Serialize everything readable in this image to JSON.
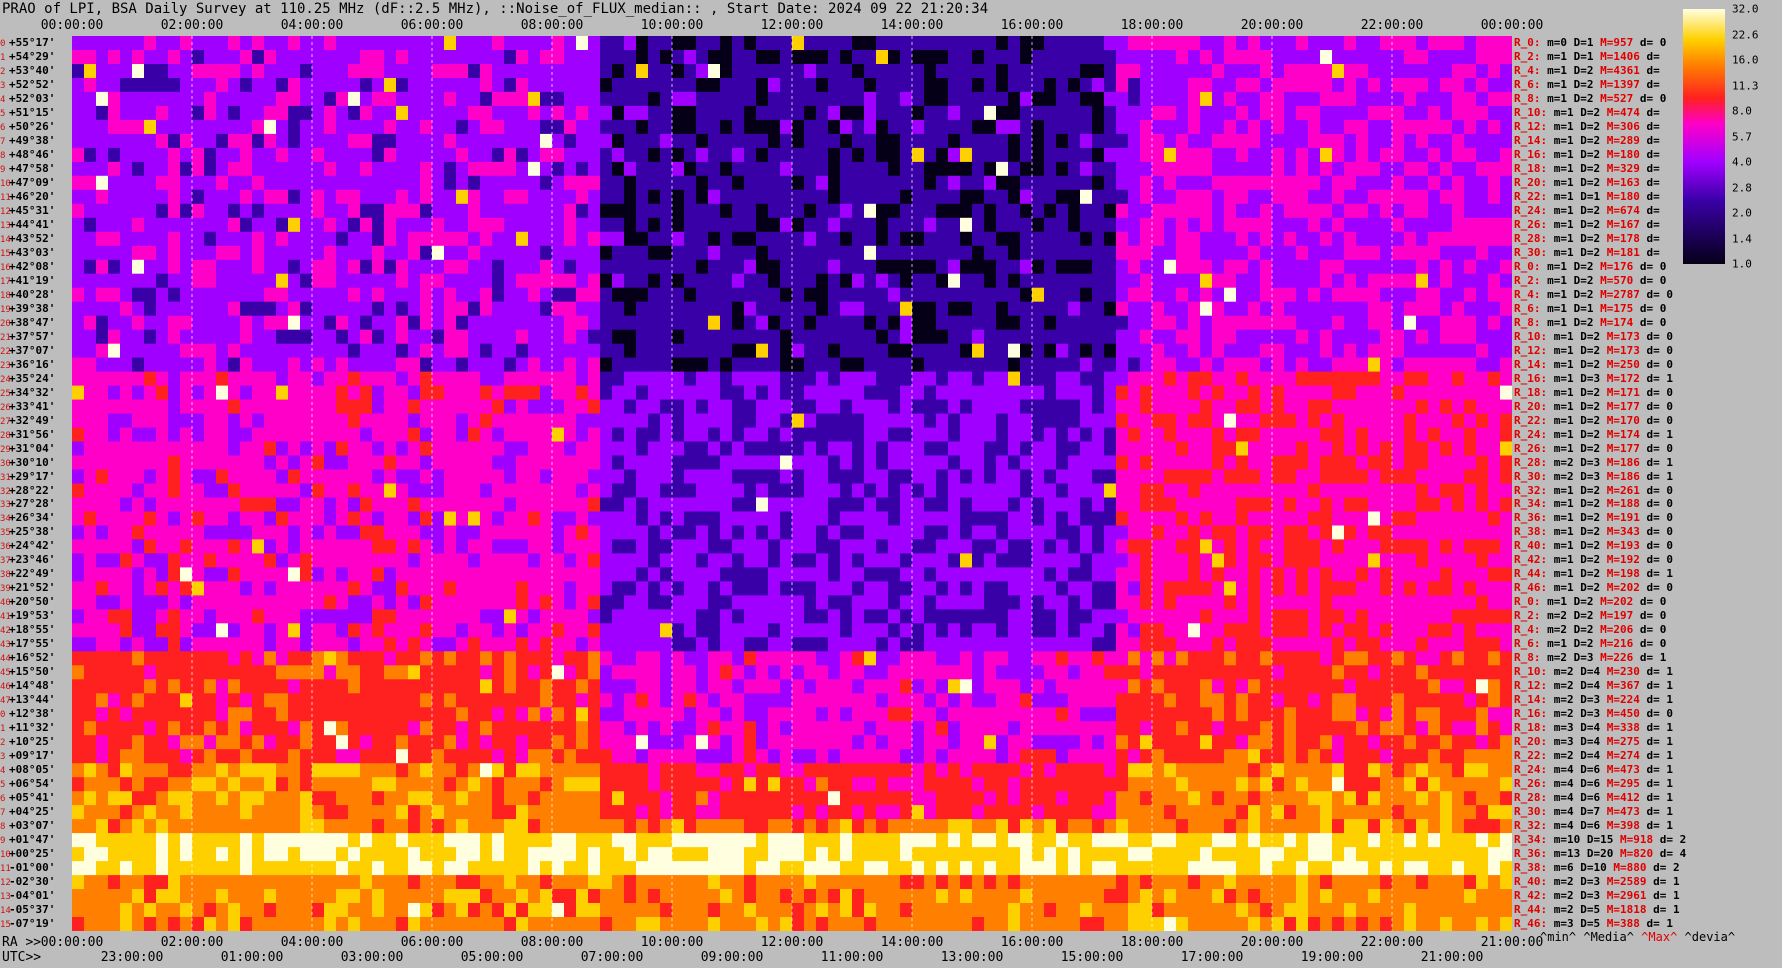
{
  "title": "PRAO of LPI, BSA Daily Survey at 110.25 MHz (dF::2.5 MHz), ::Noise_of_FLUX_median:: , Start Date: 2024 09 22 21:20:34",
  "top_axis": [
    "00:00:00",
    "02:00:00",
    "04:00:00",
    "06:00:00",
    "08:00:00",
    "10:00:00",
    "12:00:00",
    "14:00:00",
    "16:00:00",
    "18:00:00",
    "20:00:00",
    "22:00:00",
    "00:00:00"
  ],
  "ra_axis": {
    "prefix": "RA >>",
    "labels": [
      "00:00:00",
      "02:00:00",
      "04:00:00",
      "06:00:00",
      "08:00:00",
      "10:00:00",
      "12:00:00",
      "14:00:00",
      "16:00:00",
      "18:00:00",
      "20:00:00",
      "22:00:00",
      "21:00:00"
    ]
  },
  "utc_axis": {
    "prefix": "UTC>>",
    "labels": [
      "23:00:00",
      "01:00:00",
      "03:00:00",
      "05:00:00",
      "07:00:00",
      "09:00:00",
      "11:00:00",
      "13:00:00",
      "15:00:00",
      "17:00:00",
      "19:00:00",
      "21:00:00"
    ]
  },
  "colorbar": {
    "ticks": [
      "32.0",
      "22.6",
      "16.0",
      "11.3",
      "8.0",
      "5.7",
      "4.0",
      "2.8",
      "2.0",
      "1.4",
      "1.0"
    ]
  },
  "declinations": [
    "+55°17'",
    "+54°29'",
    "+53°40'",
    "+52°52'",
    "+52°03'",
    "+51°15'",
    "+50°26'",
    "+49°38'",
    "+48°46'",
    "+47°58'",
    "+47°09'",
    "+46°20'",
    "+45°31'",
    "+44°41'",
    "+43°52'",
    "+43°03'",
    "+42°08'",
    "+41°19'",
    "+40°28'",
    "+39°38'",
    "+38°47'",
    "+37°57'",
    "+37°07'",
    "+36°16'",
    "+35°24'",
    "+34°32'",
    "+33°41'",
    "+32°49'",
    "+31°56'",
    "+31°04'",
    "+30°10'",
    "+29°17'",
    "+28°22'",
    "+27°28'",
    "+26°34'",
    "+25°38'",
    "+24°42'",
    "+23°46'",
    "+22°49'",
    "+21°52'",
    "+20°50'",
    "+19°53'",
    "+18°55'",
    "+17°55'",
    "+16°52'",
    "+15°50'",
    "+14°48'",
    "+13°44'",
    "+12°38'",
    "+11°32'",
    "+10°25'",
    "+09°17'",
    "+08°05'",
    "+06°54'",
    "+05°41'",
    "+04°25'",
    "+03°07'",
    "+01°47'",
    "+00°25'",
    "-01°00'",
    "-02°30'",
    "-04°01'",
    "-05°37'",
    "-07°19'"
  ],
  "stats": [
    {
      "r": "R_0:",
      "m": "m=0",
      "d": "D=1",
      "mx": "M=957",
      "dev": "d= 0"
    },
    {
      "r": "R_2:",
      "m": "m=1",
      "d": "D=1",
      "mx": "M=1406",
      "dev": "d="
    },
    {
      "r": "R_4:",
      "m": "m=1",
      "d": "D=2",
      "mx": "M=4361",
      "dev": "d="
    },
    {
      "r": "R_6:",
      "m": "m=1",
      "d": "D=2",
      "mx": "M=1397",
      "dev": "d="
    },
    {
      "r": "R_8:",
      "m": "m=1",
      "d": "D=2",
      "mx": "M=527",
      "dev": "d= 0"
    },
    {
      "r": "R_10:",
      "m": "m=1",
      "d": "D=2",
      "mx": "M=474",
      "dev": "d="
    },
    {
      "r": "R_12:",
      "m": "m=1",
      "d": "D=2",
      "mx": "M=306",
      "dev": "d="
    },
    {
      "r": "R_14:",
      "m": "m=1",
      "d": "D=2",
      "mx": "M=289",
      "dev": "d="
    },
    {
      "r": "R_16:",
      "m": "m=1",
      "d": "D=2",
      "mx": "M=180",
      "dev": "d="
    },
    {
      "r": "R_18:",
      "m": "m=1",
      "d": "D=2",
      "mx": "M=329",
      "dev": "d="
    },
    {
      "r": "R_20:",
      "m": "m=1",
      "d": "D=2",
      "mx": "M=163",
      "dev": "d="
    },
    {
      "r": "R_22:",
      "m": "m=1",
      "d": "D=1",
      "mx": "M=180",
      "dev": "d="
    },
    {
      "r": "R_24:",
      "m": "m=1",
      "d": "D=2",
      "mx": "M=674",
      "dev": "d="
    },
    {
      "r": "R_26:",
      "m": "m=1",
      "d": "D=2",
      "mx": "M=167",
      "dev": "d="
    },
    {
      "r": "R_28:",
      "m": "m=1",
      "d": "D=2",
      "mx": "M=178",
      "dev": "d="
    },
    {
      "r": "R_30:",
      "m": "m=1",
      "d": "D=2",
      "mx": "M=181",
      "dev": "d="
    },
    {
      "r": "R_0:",
      "m": "m=1",
      "d": "D=2",
      "mx": "M=176",
      "dev": "d= 0"
    },
    {
      "r": "R_2:",
      "m": "m=1",
      "d": "D=2",
      "mx": "M=570",
      "dev": "d= 0"
    },
    {
      "r": "R_4:",
      "m": "m=1",
      "d": "D=2",
      "mx": "M=2787",
      "dev": "d= 0"
    },
    {
      "r": "R_6:",
      "m": "m=1",
      "d": "D=1",
      "mx": "M=175",
      "dev": "d= 0"
    },
    {
      "r": "R_8:",
      "m": "m=1",
      "d": "D=2",
      "mx": "M=174",
      "dev": "d= 0"
    },
    {
      "r": "R_10:",
      "m": "m=1",
      "d": "D=2",
      "mx": "M=173",
      "dev": "d= 0"
    },
    {
      "r": "R_12:",
      "m": "m=1",
      "d": "D=2",
      "mx": "M=173",
      "dev": "d= 0"
    },
    {
      "r": "R_14:",
      "m": "m=1",
      "d": "D=2",
      "mx": "M=250",
      "dev": "d= 0"
    },
    {
      "r": "R_16:",
      "m": "m=1",
      "d": "D=3",
      "mx": "M=172",
      "dev": "d= 1"
    },
    {
      "r": "R_18:",
      "m": "m=1",
      "d": "D=2",
      "mx": "M=171",
      "dev": "d= 0"
    },
    {
      "r": "R_20:",
      "m": "m=1",
      "d": "D=2",
      "mx": "M=177",
      "dev": "d= 0"
    },
    {
      "r": "R_22:",
      "m": "m=1",
      "d": "D=2",
      "mx": "M=170",
      "dev": "d= 0"
    },
    {
      "r": "R_24:",
      "m": "m=1",
      "d": "D=2",
      "mx": "M=174",
      "dev": "d= 1"
    },
    {
      "r": "R_26:",
      "m": "m=1",
      "d": "D=2",
      "mx": "M=177",
      "dev": "d= 0"
    },
    {
      "r": "R_28:",
      "m": "m=2",
      "d": "D=3",
      "mx": "M=186",
      "dev": "d= 1"
    },
    {
      "r": "R_30:",
      "m": "m=2",
      "d": "D=3",
      "mx": "M=186",
      "dev": "d= 1"
    },
    {
      "r": "R_32:",
      "m": "m=1",
      "d": "D=2",
      "mx": "M=261",
      "dev": "d= 0"
    },
    {
      "r": "R_34:",
      "m": "m=1",
      "d": "D=2",
      "mx": "M=188",
      "dev": "d= 0"
    },
    {
      "r": "R_36:",
      "m": "m=1",
      "d": "D=2",
      "mx": "M=191",
      "dev": "d= 0"
    },
    {
      "r": "R_38:",
      "m": "m=1",
      "d": "D=2",
      "mx": "M=343",
      "dev": "d= 0"
    },
    {
      "r": "R_40:",
      "m": "m=1",
      "d": "D=2",
      "mx": "M=193",
      "dev": "d= 0"
    },
    {
      "r": "R_42:",
      "m": "m=1",
      "d": "D=2",
      "mx": "M=192",
      "dev": "d= 0"
    },
    {
      "r": "R_44:",
      "m": "m=1",
      "d": "D=2",
      "mx": "M=198",
      "dev": "d= 1"
    },
    {
      "r": "R_46:",
      "m": "m=1",
      "d": "D=2",
      "mx": "M=202",
      "dev": "d= 0"
    },
    {
      "r": "R_0:",
      "m": "m=1",
      "d": "D=2",
      "mx": "M=202",
      "dev": "d= 0"
    },
    {
      "r": "R_2:",
      "m": "m=2",
      "d": "D=2",
      "mx": "M=197",
      "dev": "d= 0"
    },
    {
      "r": "R_4:",
      "m": "m=2",
      "d": "D=2",
      "mx": "M=206",
      "dev": "d= 0"
    },
    {
      "r": "R_6:",
      "m": "m=1",
      "d": "D=2",
      "mx": "M=216",
      "dev": "d= 0"
    },
    {
      "r": "R_8:",
      "m": "m=2",
      "d": "D=3",
      "mx": "M=226",
      "dev": "d= 1"
    },
    {
      "r": "R_10:",
      "m": "m=2",
      "d": "D=4",
      "mx": "M=230",
      "dev": "d= 1"
    },
    {
      "r": "R_12:",
      "m": "m=2",
      "d": "D=4",
      "mx": "M=367",
      "dev": "d= 1"
    },
    {
      "r": "R_14:",
      "m": "m=2",
      "d": "D=3",
      "mx": "M=224",
      "dev": "d= 1"
    },
    {
      "r": "R_16:",
      "m": "m=2",
      "d": "D=3",
      "mx": "M=450",
      "dev": "d= 0"
    },
    {
      "r": "R_18:",
      "m": "m=3",
      "d": "D=4",
      "mx": "M=338",
      "dev": "d= 1"
    },
    {
      "r": "R_20:",
      "m": "m=3",
      "d": "D=4",
      "mx": "M=275",
      "dev": "d= 1"
    },
    {
      "r": "R_22:",
      "m": "m=2",
      "d": "D=4",
      "mx": "M=274",
      "dev": "d= 1"
    },
    {
      "r": "R_24:",
      "m": "m=4",
      "d": "D=6",
      "mx": "M=473",
      "dev": "d= 1"
    },
    {
      "r": "R_26:",
      "m": "m=4",
      "d": "D=6",
      "mx": "M=295",
      "dev": "d= 1"
    },
    {
      "r": "R_28:",
      "m": "m=4",
      "d": "D=6",
      "mx": "M=412",
      "dev": "d= 1"
    },
    {
      "r": "R_30:",
      "m": "m=4",
      "d": "D=7",
      "mx": "M=473",
      "dev": "d= 1"
    },
    {
      "r": "R_32:",
      "m": "m=4",
      "d": "D=6",
      "mx": "M=398",
      "dev": "d= 1"
    },
    {
      "r": "R_34:",
      "m": "m=10",
      "d": "D=15",
      "mx": "M=918",
      "dev": "d= 2"
    },
    {
      "r": "R_36:",
      "m": "m=13",
      "d": "D=20",
      "mx": "M=820",
      "dev": "d= 4"
    },
    {
      "r": "R_38:",
      "m": "m=6",
      "d": "D=10",
      "mx": "M=880",
      "dev": "d= 2"
    },
    {
      "r": "R_40:",
      "m": "m=2",
      "d": "D=3",
      "mx": "M=2589",
      "dev": "d= 1"
    },
    {
      "r": "R_42:",
      "m": "m=2",
      "d": "D=3",
      "mx": "M=2961",
      "dev": "d= 1"
    },
    {
      "r": "R_44:",
      "m": "m=2",
      "d": "D=5",
      "mx": "M=1818",
      "dev": "d= 1"
    },
    {
      "r": "R_46:",
      "m": "m=3",
      "d": "D=5",
      "mx": "M=388",
      "dev": "d= 1"
    }
  ],
  "stats_footer": {
    "min": "^min^",
    "media": "^Media^",
    "max": "^Max^",
    "devia": "^devia^"
  },
  "chart_data": {
    "type": "heatmap",
    "title": "PRAO of LPI, BSA Daily Survey at 110.25 MHz (dF::2.5 MHz), ::Noise_of_FLUX_median:: , Start Date: 2024 09 22 21:20:34",
    "xlabel": "RA >> / UTC>>",
    "ylabel": "",
    "x_ticks": [
      "00:00:00",
      "02:00:00",
      "04:00:00",
      "06:00:00",
      "08:00:00",
      "10:00:00",
      "12:00:00",
      "14:00:00",
      "16:00:00",
      "18:00:00",
      "20:00:00",
      "22:00:00",
      "00:00:00"
    ],
    "colorbar_ticks": [
      32.0,
      22.6,
      16.0,
      11.3,
      8.0,
      5.7,
      4.0,
      2.8,
      2.0,
      1.4,
      1.0
    ],
    "colormap": [
      "#050018",
      "#3a00a8",
      "#a000ff",
      "#ff00c8",
      "#ff2020",
      "#ff8000",
      "#ffd000",
      "#ffffe0"
    ],
    "rows": 64
  }
}
